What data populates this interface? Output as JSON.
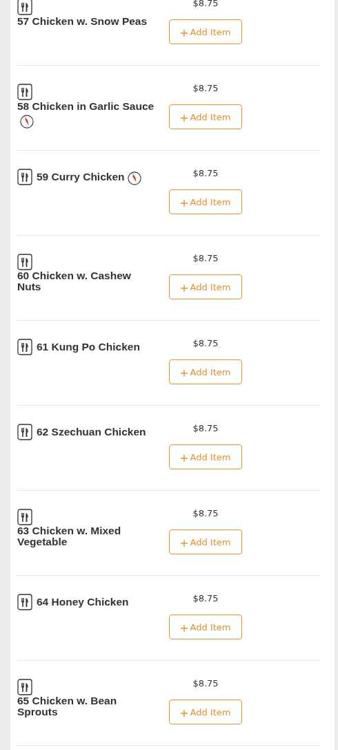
{
  "items": [
    {
      "name": "57 Chicken w. Snow Peas",
      "spicy": false,
      "price": "$8.75",
      "button": "Add Item"
    },
    {
      "name": "58 Chicken in Garlic Sauce",
      "spicy": true,
      "price": "$8.75",
      "button": "Add Item"
    },
    {
      "name": "59 Curry Chicken",
      "spicy": true,
      "price": "$8.75",
      "button": "Add Item"
    },
    {
      "name": "60 Chicken w. Cashew Nuts",
      "spicy": false,
      "price": "$8.75",
      "button": "Add Item"
    },
    {
      "name": "61 Kung Po Chicken",
      "spicy": false,
      "price": "$8.75",
      "button": "Add Item"
    },
    {
      "name": "62 Szechuan Chicken",
      "spicy": false,
      "price": "$8.75",
      "button": "Add Item"
    },
    {
      "name": "63 Chicken w. Mixed Vegetable",
      "spicy": false,
      "price": "$8.75",
      "button": "Add Item"
    },
    {
      "name": "64 Honey Chicken",
      "spicy": false,
      "price": "$8.75",
      "button": "Add Item"
    },
    {
      "name": "65 Chicken w. Bean Sprouts",
      "spicy": false,
      "price": "$8.75",
      "button": "Add Item"
    }
  ]
}
